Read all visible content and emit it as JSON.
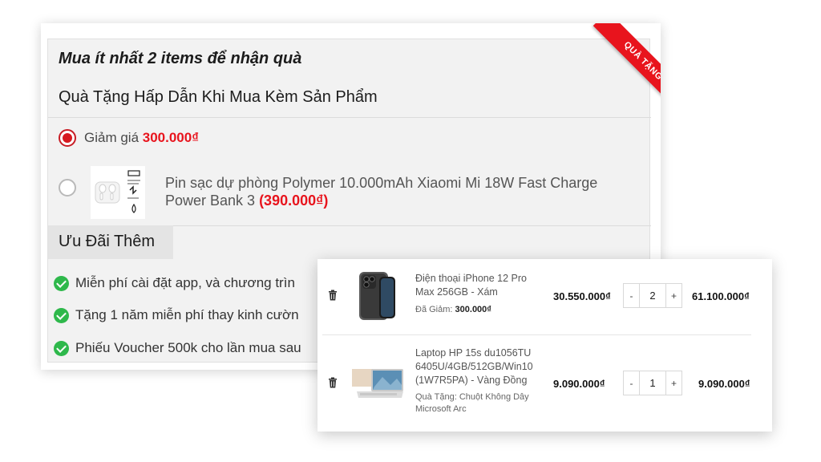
{
  "promo": {
    "heading": "Mua ít nhất 2 items để nhận quà",
    "subheading": "Quà Tặng Hấp Dẫn Khi Mua Kèm Sản Phẩm",
    "ribbon": "QUÀ TẶNG",
    "options": [
      {
        "label": "Giảm giá ",
        "price": "300.000₫",
        "selected": true
      },
      {
        "label": "Pin sạc dự phòng Polymer 10.000mAh Xiaomi Mi 18W Fast Charge Power Bank 3 ",
        "price": "(390.000₫)",
        "selected": false
      }
    ],
    "extra_title": "Ưu Đãi Thêm",
    "perks": [
      "Miễn phí cài đặt app, và chương trìn",
      "Tặng 1 năm miễn phí thay kinh cườn",
      "Phiếu Voucher 500k cho lần mua sau"
    ]
  },
  "cart": {
    "items": [
      {
        "name": "Điện thoại iPhone 12 Pro Max 256GB - Xám",
        "note_label": "Đã Giảm:",
        "note_value": "300.000₫",
        "unit_price": "30.550.000₫",
        "qty_minus": "-",
        "quantity": "2",
        "qty_plus": "+",
        "total": "61.100.000₫"
      },
      {
        "name": "Laptop HP 15s du1056TU 6405U/4GB/512GB/Win10 (1W7R5PA) - Vàng Đồng",
        "note_label": "Quà Tặng:",
        "note_value": "Chuột Không Dây Microsoft Arc",
        "unit_price": "9.090.000₫",
        "qty_minus": "-",
        "quantity": "1",
        "qty_plus": "+",
        "total": "9.090.000₫"
      }
    ]
  },
  "colors": {
    "accent_red": "#e8141d",
    "check_green": "#2eb84b"
  }
}
